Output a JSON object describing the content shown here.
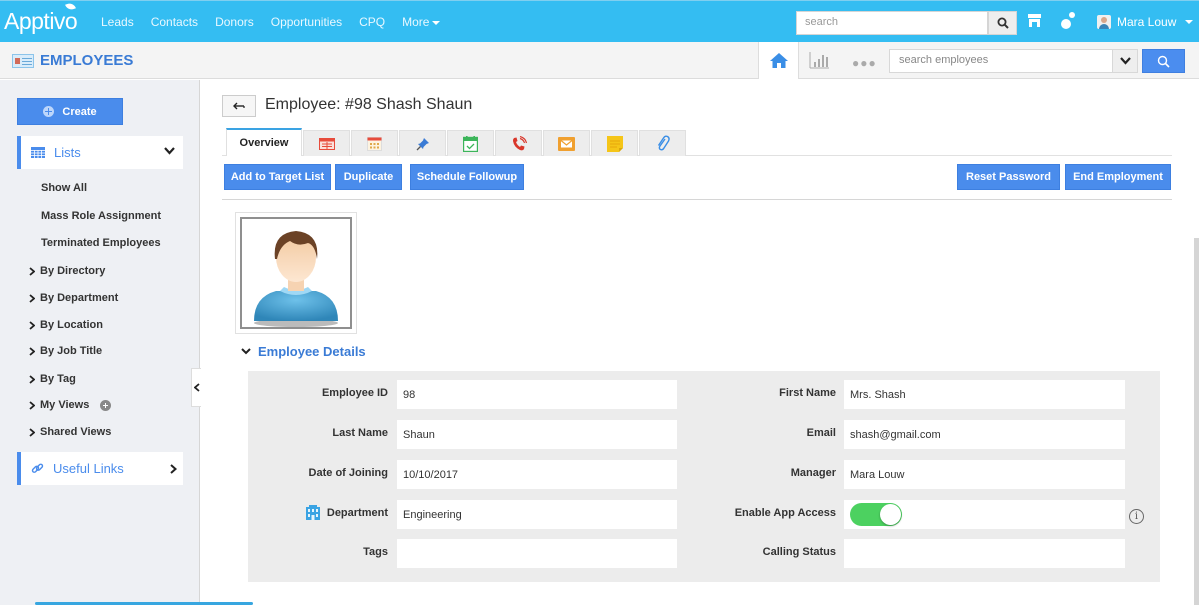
{
  "topbar": {
    "logo": "Apptivo",
    "nav": [
      "Leads",
      "Contacts",
      "Donors",
      "Opportunities",
      "CPQ",
      "More"
    ],
    "search_placeholder": "search",
    "user_name": "Mara Louw"
  },
  "subbar": {
    "app_title": "EMPLOYEES",
    "search_placeholder": "search employees",
    "dots": "●●●"
  },
  "sidebar": {
    "create_label": "Create",
    "lists_label": "Lists",
    "list_links": [
      "Show All",
      "Mass Role Assignment",
      "Terminated Employees"
    ],
    "tree_links": [
      "By Directory",
      "By Department",
      "By Location",
      "By Job Title",
      "By Tag",
      "My Views",
      "Shared Views"
    ],
    "useful_links_label": "Useful Links"
  },
  "main": {
    "title": "Employee: #98 Shash Shaun",
    "tabs": [
      {
        "label": "Overview",
        "icon": "overview"
      },
      {
        "label": "",
        "icon": "table-icon",
        "color": "#e74c3c"
      },
      {
        "label": "",
        "icon": "calendar-icon",
        "color": "#e74c3c"
      },
      {
        "label": "",
        "icon": "pin-icon",
        "color": "#3a7bd5"
      },
      {
        "label": "",
        "icon": "calendar-check-icon",
        "color": "#3cb55a"
      },
      {
        "label": "",
        "icon": "phone-icon",
        "color": "#d9372b"
      },
      {
        "label": "",
        "icon": "mail-icon",
        "color": "#f0a030"
      },
      {
        "label": "",
        "icon": "note-icon",
        "color": "#f5c518"
      },
      {
        "label": "",
        "icon": "paperclip-icon",
        "color": "#3a8ee6"
      }
    ],
    "actions_left": [
      "Add to Target List",
      "Duplicate",
      "Schedule Followup"
    ],
    "actions_right": [
      "Reset Password",
      "End Employment"
    ],
    "section_title": "Employee Details",
    "fields_left": [
      {
        "label": "Employee ID",
        "value": "98"
      },
      {
        "label": "Last Name",
        "value": "Shaun"
      },
      {
        "label": "Date of Joining",
        "value": "10/10/2017"
      },
      {
        "label": "Department",
        "value": "Engineering"
      },
      {
        "label": "Tags",
        "value": ""
      }
    ],
    "fields_right": [
      {
        "label": "First Name",
        "value": "Mrs. Shash"
      },
      {
        "label": "Email",
        "value": "shash@gmail.com"
      },
      {
        "label": "Manager",
        "value": "Mara Louw"
      },
      {
        "label": "Enable App Access",
        "value": "on"
      },
      {
        "label": "Calling Status",
        "value": ""
      }
    ],
    "info_glyph": "i"
  },
  "colors": {
    "topbar": "#34bdf2",
    "accent": "#4a8cec",
    "toggle_on": "#4cd160"
  }
}
